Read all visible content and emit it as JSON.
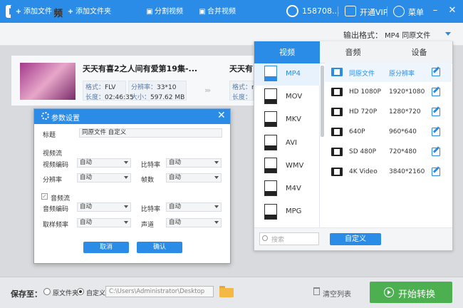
{
  "app": {
    "title": "迅捷视频转换器",
    "user": "158708...",
    "vip": "开通VIP",
    "menu": "菜单"
  },
  "toolbar": {
    "add_file": "添加文件",
    "add_folder": "添加文件夹",
    "split": "分割视频",
    "merge": "合并视频",
    "output_format_label": "输出格式：",
    "output_format_value": "MP4 同原文件"
  },
  "file": {
    "name": "天天有喜2之人间有爱第19集-...",
    "format_label": "格式：",
    "format": "FLV",
    "resolution_label": "分辨率：",
    "resolution": "33*10",
    "duration_label": "长度：",
    "duration": "02:46:35",
    "size_label": "大小：",
    "size": "597.62 MB",
    "name2": "天天有",
    "format_label2": "格式：",
    "format2": "r",
    "duration_label2": "长度："
  },
  "format_panel": {
    "tabs": [
      "视频",
      "音频",
      "设备"
    ],
    "formats": [
      "MP4",
      "MOV",
      "MKV",
      "AVI",
      "WMV",
      "M4V",
      "MPG"
    ],
    "qualities": [
      {
        "name": "同原文件",
        "res": "原分辨率"
      },
      {
        "name": "HD 1080P",
        "res": "1920*1080"
      },
      {
        "name": "HD 720P",
        "res": "1280*720"
      },
      {
        "name": "640P",
        "res": "960*640"
      },
      {
        "name": "SD 480P",
        "res": "720*480"
      },
      {
        "name": "4K Video",
        "res": "3840*2160"
      }
    ],
    "search_placeholder": "搜索",
    "custom": "自定义"
  },
  "dialog": {
    "title": "参数设置",
    "label_title": "标题",
    "title_value": "同原文件 自定义",
    "video_stream": "视频流",
    "video_codec": "视频编码",
    "video_codec_val": "自动",
    "bitrate": "比特率",
    "bitrate_val": "自动",
    "resolution": "分辨率",
    "resolution_val": "自动",
    "fps": "帧数",
    "fps_val": "自动",
    "audio_stream": "音频流",
    "audio_codec": "音频编码",
    "audio_codec_val": "自动",
    "abitrate": "比特率",
    "abitrate_val": "自动",
    "samplerate": "取样频率",
    "samplerate_val": "自动",
    "channel": "声道",
    "channel_val": "自动",
    "cancel": "取消",
    "ok": "确认"
  },
  "bottom": {
    "save_to": "保存至：",
    "opt_original": "原文件夹",
    "opt_custom": "自定义",
    "path": "C:\\Users\\Administrator\\Desktop",
    "clear": "清空列表",
    "start": "开始转换"
  },
  "colors": {
    "accent": "#2a8ce6",
    "start": "#4caf50"
  }
}
